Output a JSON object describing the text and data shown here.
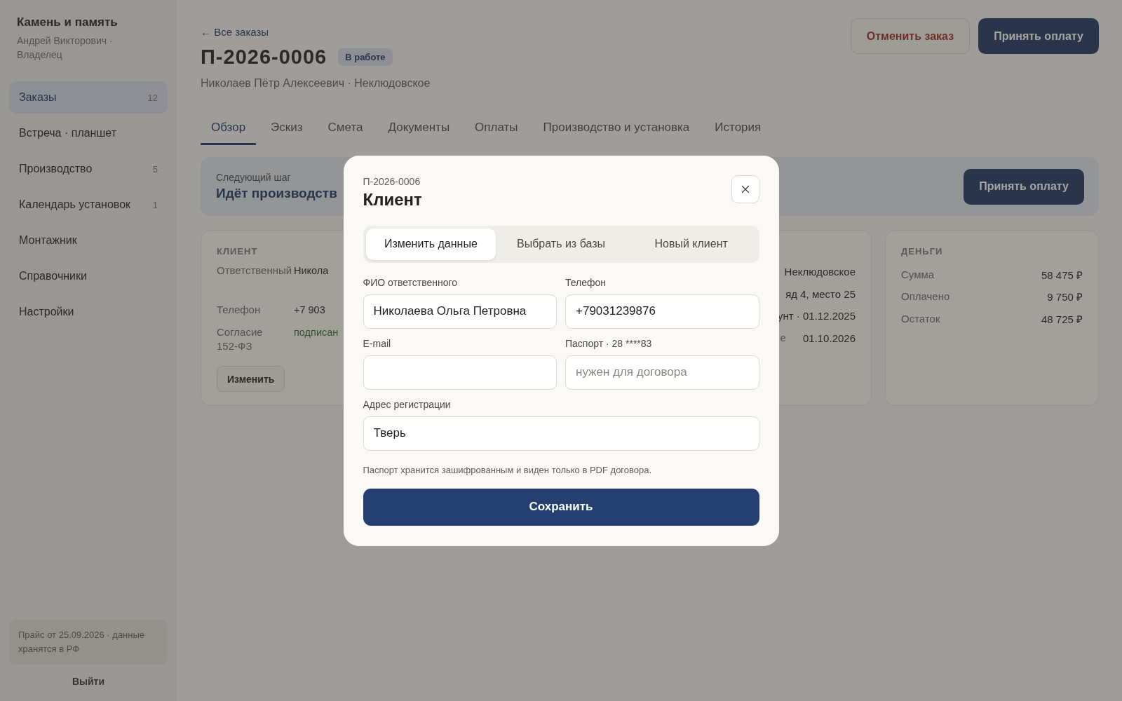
{
  "sidebar": {
    "brand": "Камень и память",
    "user": "Андрей Викторович · Владелец",
    "nav": [
      {
        "label": "Заказы",
        "count": "12",
        "selected": true
      },
      {
        "label": "Встреча · планшет",
        "selected": false
      },
      {
        "label": "Производство",
        "count": "5",
        "selected": false
      },
      {
        "label": "Календарь установок",
        "count": "1",
        "selected": false
      },
      {
        "label": "Монтажник",
        "selected": false
      },
      {
        "label": "Справочники",
        "selected": false
      },
      {
        "label": "Настройки",
        "selected": false
      }
    ],
    "note": "Прайс от 25.09.2026 · данные хранятся в РФ",
    "logout": "Выйти"
  },
  "header": {
    "back": "← Все заказы",
    "order_id": "П-2026-0006",
    "status": "В работе",
    "client_line": "Николаев Пётр Алексеевич · Неклюдовское",
    "actions": [
      {
        "label": "Отменить заказ",
        "kind": "danger"
      },
      {
        "label": "Принять оплату",
        "kind": "primary"
      }
    ]
  },
  "tabs": [
    {
      "label": "Обзор",
      "selected": true
    },
    {
      "label": "Эскиз",
      "selected": false
    },
    {
      "label": "Смета",
      "selected": false
    },
    {
      "label": "Документы",
      "selected": false
    },
    {
      "label": "Оплаты",
      "selected": false
    },
    {
      "label": "Производство и установка",
      "selected": false
    },
    {
      "label": "История",
      "selected": false
    }
  ],
  "next_step": {
    "label": "Следующий шаг",
    "title": "Идёт производств",
    "action": "Принять оплату"
  },
  "client_card": {
    "heading": "КЛИЕНТ",
    "rows": [
      {
        "label": "Ответственный",
        "value": "Никола",
        "kind": "plain"
      },
      {
        "label": "Телефон",
        "value": "+7 903",
        "kind": "plain"
      },
      {
        "label": "Согласие 152-ФЗ",
        "value": "подписан",
        "kind": "positive"
      }
    ],
    "button": "Изменить"
  },
  "object_card": {
    "rows": [
      {
        "value": "Неклюдовское"
      },
      {
        "value": "яд 4, место 25"
      },
      {
        "value": "унт · 01.12.2025"
      },
      {
        "label": "е",
        "value": "01.10.2026"
      }
    ]
  },
  "money_card": {
    "heading": "ДЕНЬГИ",
    "rows": [
      {
        "label": "Сумма",
        "value": "58 475 ₽"
      },
      {
        "label": "Оплачено",
        "value": "9 750 ₽"
      },
      {
        "label": "Остаток",
        "value": "48 725 ₽"
      }
    ]
  },
  "modal": {
    "order_id": "П-2026-0006",
    "title": "Клиент",
    "segments": [
      {
        "label": "Изменить данные",
        "selected": true
      },
      {
        "label": "Выбрать из базы",
        "selected": false
      },
      {
        "label": "Новый клиент",
        "selected": false
      }
    ],
    "field_rows": [
      [
        {
          "label": "ФИО ответственного",
          "value": "Николаева Ольга Петровна"
        },
        {
          "label": "Телефон",
          "value": "+79031239876"
        }
      ],
      [
        {
          "label": "E-mail"
        },
        {
          "label": "Паспорт · 28 ****83",
          "placeholder": "нужен для договора"
        }
      ],
      [
        {
          "label": "Адрес регистрации",
          "value": "Тверь"
        }
      ]
    ],
    "note": "Паспорт хранится зашифрованным и виден только в PDF договора.",
    "save": "Сохранить"
  }
}
